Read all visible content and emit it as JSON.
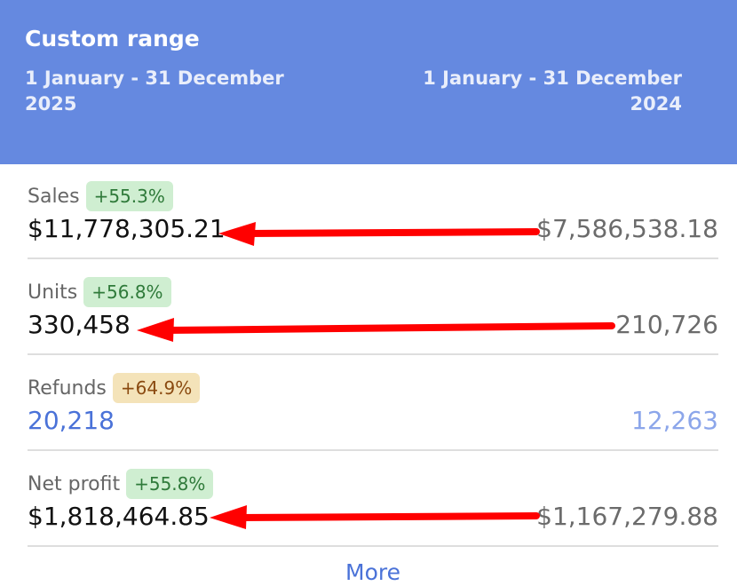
{
  "header": {
    "title": "Custom range",
    "current_range": "1 January - 31 December 2025",
    "previous_range": "1 January - 31 December 2024",
    "background": "#6589e0"
  },
  "metrics": [
    {
      "label": "Sales",
      "change": "+55.3%",
      "badge": "green",
      "current": "$11,778,305.21",
      "previous": "$7,586,538.18"
    },
    {
      "label": "Units",
      "change": "+56.8%",
      "badge": "green",
      "current": "330,458",
      "previous": "210,726"
    },
    {
      "label": "Refunds",
      "change": "+64.9%",
      "badge": "amber",
      "current": "20,218",
      "previous": "12,263"
    },
    {
      "label": "Net profit",
      "change": "+55.8%",
      "badge": "green",
      "current": "$1,818,464.85",
      "previous": "$1,167,279.88"
    }
  ],
  "footer": {
    "more_label": "More"
  },
  "colors": {
    "arrow": "#ff0000",
    "positive": "#cfeed1",
    "warning": "#f4e3b9",
    "link": "#4a72d8"
  }
}
